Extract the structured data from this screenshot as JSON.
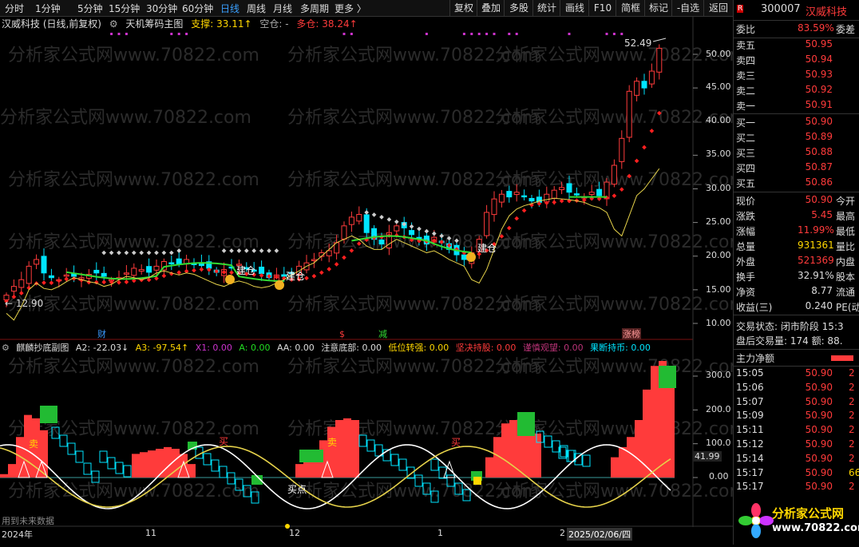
{
  "toolbar": {
    "periods": [
      {
        "label": "分时",
        "active": false
      },
      {
        "label": "1分钟",
        "active": false
      },
      {
        "label": "5分钟",
        "active": false
      },
      {
        "label": "15分钟",
        "active": false
      },
      {
        "label": "30分钟",
        "active": false
      },
      {
        "label": "60分钟",
        "active": false
      },
      {
        "label": "日线",
        "active": true
      },
      {
        "label": "周线",
        "active": false
      },
      {
        "label": "月线",
        "active": false
      },
      {
        "label": "多周期",
        "active": false
      },
      {
        "label": "更多 〉",
        "active": false
      }
    ],
    "buttons": [
      "复权",
      "叠加",
      "多股",
      "统计",
      "画线",
      "F10",
      "简框",
      "标记",
      "-自选",
      "返回"
    ]
  },
  "main_header": {
    "stock": "汉威科技 (日线,前复权)",
    "indicator": "天机筹码主图",
    "support_label": "支撑: 33.11↑",
    "empty_label": "空仓: -",
    "long_label": "多仓: 38.24↑"
  },
  "price_axis": [
    "50.00",
    "45.00",
    "40.00",
    "35.00",
    "30.00",
    "25.00",
    "20.00",
    "15.00",
    "10.00"
  ],
  "main_annotations": {
    "high": "52.49",
    "low": "12.90",
    "jiancang": "建仓",
    "cai": "财",
    "jian": "减",
    "zhangting": "涨榜"
  },
  "sub_header": {
    "title": "麒麟抄底副图",
    "a2": "A2: -22.03↓",
    "a3": "A3: -97.54↑",
    "x1": "X1: 0.00",
    "a": "A: 0.00",
    "aa": "AA: 0.00",
    "zhuyi": "注意底部: 0.00",
    "diwei": "低位转强: 0.00",
    "jianjue": "坚决持股: 0.00",
    "jinshen": "谨慎观望: 0.00",
    "guoduan": "果断持币: 0.00"
  },
  "sub_axis": [
    "300.0",
    "200.0",
    "100.0",
    "0.00"
  ],
  "sub_current": "41.99",
  "sub_labels": {
    "sell": "卖",
    "buy": "买",
    "buypoint": "买点",
    "future": "用到未来数据"
  },
  "date_axis": [
    "2024年",
    "11",
    "12",
    "1",
    "2"
  ],
  "cursor_date": "2025/02/06/四",
  "watermark": "分析家公式网www.70822.com",
  "logo": {
    "title": "分析家公式网",
    "url": "www.70822.com"
  },
  "quote": {
    "code": "300007",
    "name": "汉威科技",
    "weibi_label": "委比",
    "weibi_val": "83.59%",
    "weicha_label": "委差",
    "asks": [
      {
        "label": "卖五",
        "price": "50.95"
      },
      {
        "label": "卖四",
        "price": "50.94"
      },
      {
        "label": "卖三",
        "price": "50.93"
      },
      {
        "label": "卖二",
        "price": "50.92"
      },
      {
        "label": "卖一",
        "price": "50.91"
      }
    ],
    "bids": [
      {
        "label": "买一",
        "price": "50.90"
      },
      {
        "label": "买二",
        "price": "50.89"
      },
      {
        "label": "买三",
        "price": "50.88"
      },
      {
        "label": "买四",
        "price": "50.87"
      },
      {
        "label": "买五",
        "price": "50.86"
      }
    ],
    "stats": [
      {
        "l": "现价",
        "v": "50.90",
        "r": "今开",
        "c": "red"
      },
      {
        "l": "涨跌",
        "v": "5.45",
        "r": "最高",
        "c": "red"
      },
      {
        "l": "涨幅",
        "v": "11.99%",
        "r": "最低",
        "c": "red"
      },
      {
        "l": "总量",
        "v": "931361",
        "r": "量比",
        "c": "yellow"
      },
      {
        "l": "外盘",
        "v": "521369",
        "r": "内盘",
        "c": "red"
      },
      {
        "l": "换手",
        "v": "32.91%",
        "r": "股本",
        "c": "white"
      },
      {
        "l": "净资",
        "v": "8.77",
        "r": "流通",
        "c": "white"
      },
      {
        "l": "收益(三)",
        "v": "0.240",
        "r": "PE(动",
        "c": "white"
      }
    ],
    "trade_state": "交易状态: 闭市阶段 15:3",
    "after_hours": "盘后交易量: 174  额: 88.",
    "main_flow": "主力净额",
    "ticks": [
      {
        "t": "15:05",
        "p": "50.90",
        "n": "2"
      },
      {
        "t": "15:06",
        "p": "50.90",
        "n": "2"
      },
      {
        "t": "15:07",
        "p": "50.90",
        "n": "2"
      },
      {
        "t": "15:09",
        "p": "50.90",
        "n": "2"
      },
      {
        "t": "15:11",
        "p": "50.90",
        "n": "2"
      },
      {
        "t": "15:12",
        "p": "50.90",
        "n": "2"
      },
      {
        "t": "15:14",
        "p": "50.90",
        "n": "2"
      },
      {
        "t": "15:17",
        "p": "50.90",
        "n": "66"
      },
      {
        "t": "15:17",
        "p": "50.90",
        "n": "2"
      }
    ]
  },
  "colors": {
    "up": "#ff3b3b",
    "down": "#00e5ff",
    "buyline": "#ff2020",
    "stopline": "#cccccc",
    "support": "#33dd33",
    "yellowline": "#e6d24a",
    "white": "#ffffff",
    "purple": "#cc33cc"
  }
}
